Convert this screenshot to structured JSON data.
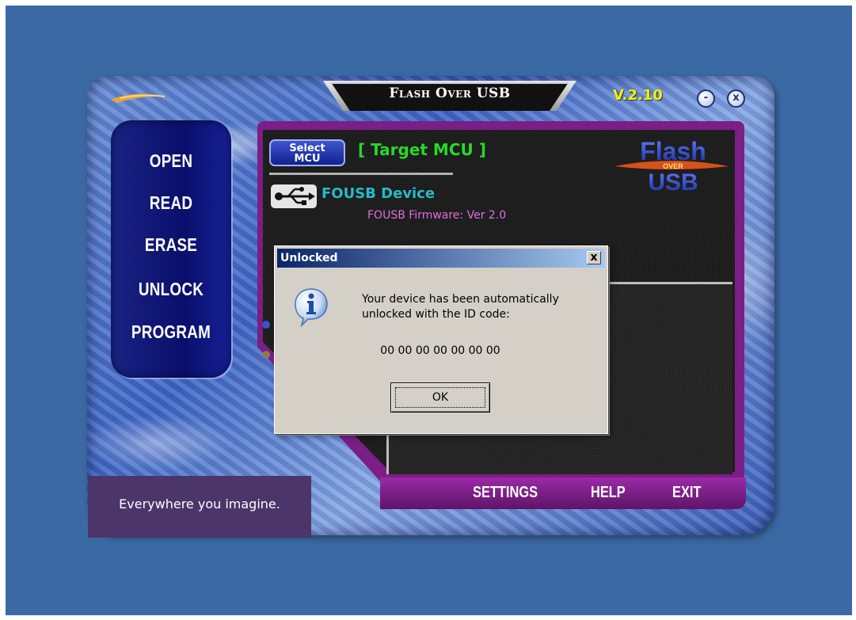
{
  "app": {
    "title": "Flash Over USB",
    "version": "V.2.10",
    "minimize_label": "-",
    "close_label": "x"
  },
  "sidebar": {
    "items": [
      {
        "label": "OPEN"
      },
      {
        "label": "READ"
      },
      {
        "label": "ERASE"
      },
      {
        "label": "UNLOCK"
      },
      {
        "label": "PROGRAM"
      }
    ]
  },
  "panel": {
    "select_mcu_label_line1": "Select",
    "select_mcu_label_line2": "MCU",
    "target_mcu": "[ Target MCU ]",
    "device_name": "FOUSB Device",
    "firmware": "FOUSB Firmware: Ver 2.0",
    "logo_top": "Flash",
    "logo_middle": "OVER",
    "logo_bottom": "USB"
  },
  "bottom_bar": {
    "settings": "SETTINGS",
    "help": "HELP",
    "exit": "EXIT"
  },
  "tagline": "Everywhere you imagine.",
  "dialog": {
    "title": "Unlocked",
    "close_label": "x",
    "message_line1": "Your device has been automatically",
    "message_line2": "unlocked with the ID code:",
    "id_code": "00 00 00 00 00 00 00",
    "ok_label": "OK",
    "icon": "information-icon"
  },
  "colors": {
    "desktop": "#3b69a4",
    "panel_border": "#7b1e86",
    "nav": "#0a0f6c",
    "target_mcu": "#29d929",
    "device_text": "#28b9c9",
    "firmware_text": "#e06fe0",
    "version": "#f2f200"
  }
}
